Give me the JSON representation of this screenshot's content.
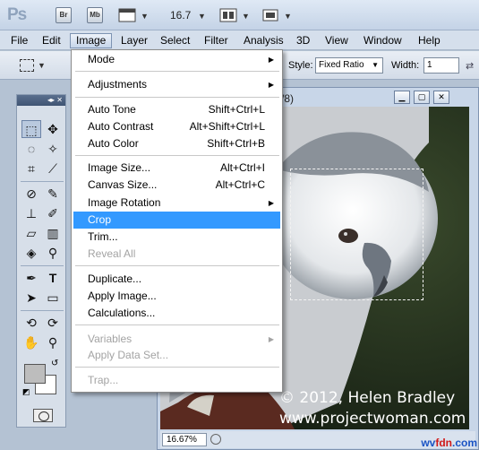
{
  "app": {
    "logo": "Ps",
    "bridge_button": "Br",
    "minibridge_button": "Mb",
    "zoom_value": "16.7"
  },
  "menubar": [
    "File",
    "Edit",
    "Image",
    "Layer",
    "Select",
    "Filter",
    "Analysis",
    "3D",
    "View",
    "Window",
    "Help"
  ],
  "options": {
    "style_label": "Style:",
    "style_value": "Fixed Ratio",
    "width_label": "Width:",
    "width_value": "1"
  },
  "document": {
    "title_fragment": "/8)",
    "zoom_status": "16.67%",
    "watermark_line1": "© 2012, Helen Bradley",
    "watermark_line2": "www.projectwoman.com"
  },
  "image_menu": {
    "mode": "Mode",
    "adjustments": "Adjustments",
    "auto_tone": "Auto Tone",
    "auto_tone_sc": "Shift+Ctrl+L",
    "auto_contrast": "Auto Contrast",
    "auto_contrast_sc": "Alt+Shift+Ctrl+L",
    "auto_color": "Auto Color",
    "auto_color_sc": "Shift+Ctrl+B",
    "image_size": "Image Size...",
    "image_size_sc": "Alt+Ctrl+I",
    "canvas_size": "Canvas Size...",
    "canvas_size_sc": "Alt+Ctrl+C",
    "image_rotation": "Image Rotation",
    "crop": "Crop",
    "trim": "Trim...",
    "reveal_all": "Reveal All",
    "duplicate": "Duplicate...",
    "apply_image": "Apply Image...",
    "calculations": "Calculations...",
    "variables": "Variables",
    "apply_data_set": "Apply Data Set...",
    "trap": "Trap..."
  },
  "site_mark": {
    "part1": "wv",
    "part2": "fdn",
    "part3": ".com"
  }
}
